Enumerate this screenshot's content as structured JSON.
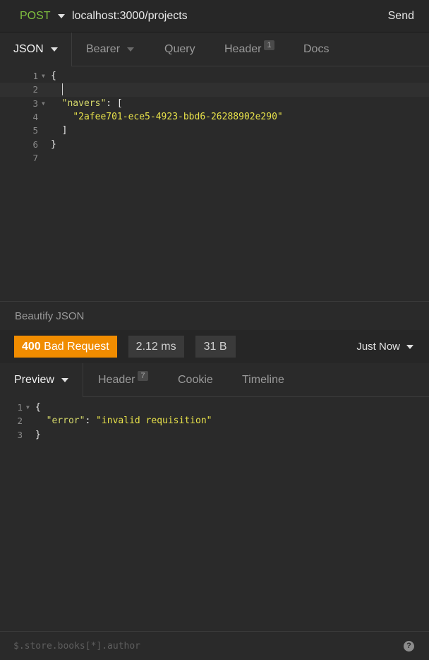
{
  "request": {
    "method": "POST",
    "url": "localhost:3000/projects",
    "send_label": "Send"
  },
  "request_tabs": [
    {
      "label": "JSON",
      "active": true,
      "dropdown": true
    },
    {
      "label": "Bearer",
      "dropdown": true
    },
    {
      "label": "Query"
    },
    {
      "label": "Header",
      "badge": "1"
    },
    {
      "label": "Docs"
    }
  ],
  "request_body": {
    "line_numbers": [
      "1",
      "2",
      "3",
      "4",
      "5",
      "6",
      "7"
    ],
    "lines": {
      "l1": "{",
      "l3_key": "\"navers\"",
      "l3_rest": ": [",
      "l4_value": "\"2afee701-ece5-4923-bbd6-26288902e290\"",
      "l5": "]",
      "l6": "}"
    }
  },
  "beautify_label": "Beautify JSON",
  "response_status": {
    "code": "400",
    "text": "Bad Request",
    "time": "2.12 ms",
    "size": "31 B",
    "time_ago": "Just Now"
  },
  "response_tabs": [
    {
      "label": "Preview",
      "active": true,
      "dropdown": true
    },
    {
      "label": "Header",
      "badge": "7"
    },
    {
      "label": "Cookie"
    },
    {
      "label": "Timeline"
    }
  ],
  "response_body": {
    "line_numbers": [
      "1",
      "2",
      "3"
    ],
    "lines": {
      "l1": "{",
      "l2_key": "\"error\"",
      "l2_sep": ": ",
      "l2_value": "\"invalid requisition\"",
      "l3": "}"
    }
  },
  "filter": {
    "placeholder": "$.store.books[*].author",
    "help_icon": "?"
  },
  "colors": {
    "method": "#7fbf3f",
    "status_error": "#f08c00",
    "json_string": "#e8e24a"
  }
}
